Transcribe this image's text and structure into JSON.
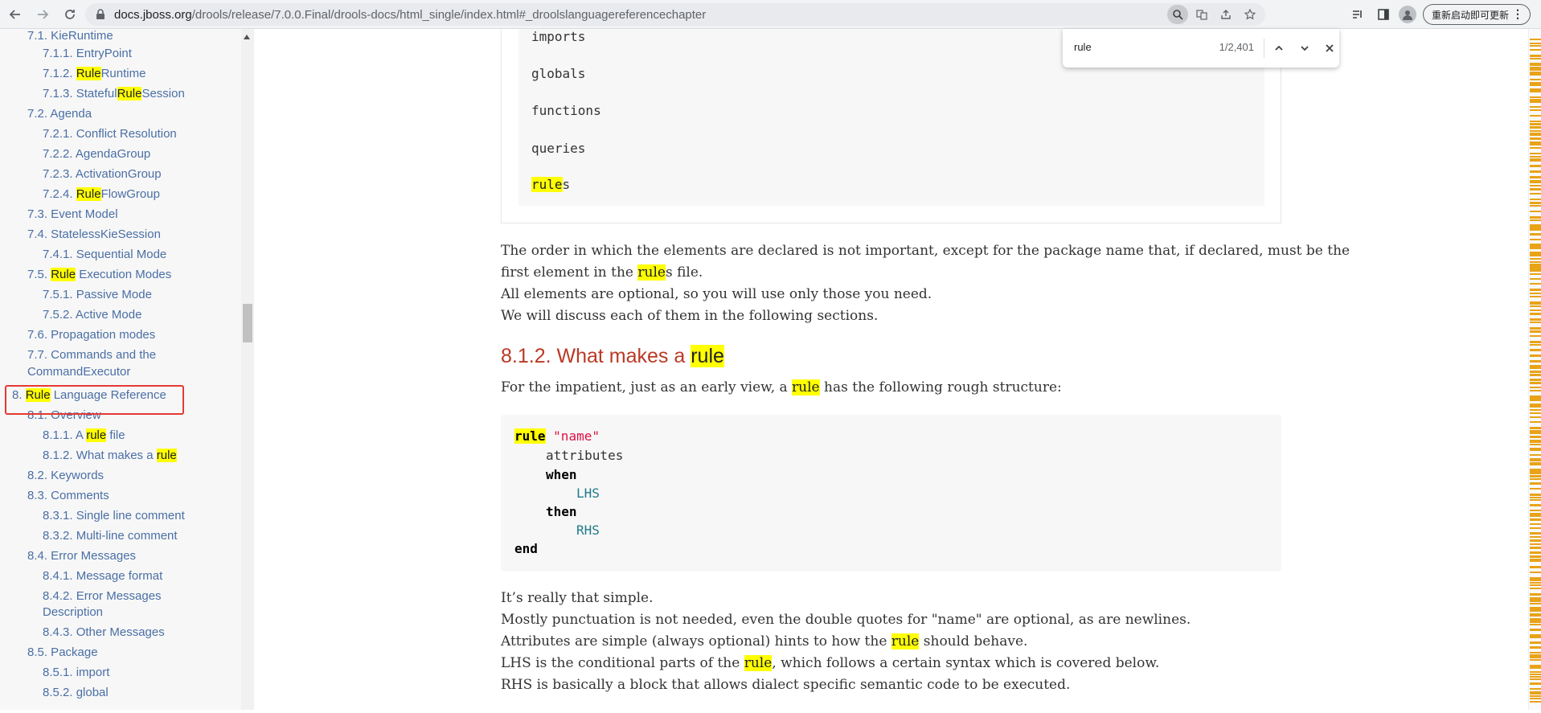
{
  "browser": {
    "url_host": "docs.jboss.org",
    "url_path": "/drools/release/7.0.0.Final/drools-docs/html_single/index.html#_droolslanguagereferencechapter",
    "update_button": "重新启动即可更新"
  },
  "find_bar": {
    "query": "rule",
    "count": "1/2,401"
  },
  "sidebar": {
    "items": [
      {
        "pre": "7.1. KieRuntime",
        "hl": "",
        "post": ""
      },
      {
        "pre": "7.1.1. EntryPoint",
        "hl": "",
        "post": ""
      },
      {
        "pre": "7.1.2. ",
        "hl": "Rule",
        "post": "Runtime"
      },
      {
        "pre": "7.1.3. Stateful",
        "hl": "Rule",
        "post": "Session"
      },
      {
        "pre": "7.2. Agenda",
        "hl": "",
        "post": ""
      },
      {
        "pre": "7.2.1. Conflict Resolution",
        "hl": "",
        "post": ""
      },
      {
        "pre": "7.2.2. AgendaGroup",
        "hl": "",
        "post": ""
      },
      {
        "pre": "7.2.3. ActivationGroup",
        "hl": "",
        "post": ""
      },
      {
        "pre": "7.2.4. ",
        "hl": "Rule",
        "post": "FlowGroup"
      },
      {
        "pre": "7.3. Event Model",
        "hl": "",
        "post": ""
      },
      {
        "pre": "7.4. StatelessKieSession",
        "hl": "",
        "post": ""
      },
      {
        "pre": "7.4.1. Sequential Mode",
        "hl": "",
        "post": ""
      },
      {
        "pre": "7.5. ",
        "hl": "Rule",
        "post": " Execution Modes"
      },
      {
        "pre": "7.5.1. Passive Mode",
        "hl": "",
        "post": ""
      },
      {
        "pre": "7.5.2. Active Mode",
        "hl": "",
        "post": ""
      },
      {
        "pre": "7.6. Propagation modes",
        "hl": "",
        "post": ""
      },
      {
        "pre": "7.7. Commands and the",
        "hl": "",
        "post": ""
      },
      {
        "pre": "CommandExecutor",
        "hl": "",
        "post": ""
      },
      {
        "pre": "8. ",
        "hl": "Rule",
        "post": " Language Reference"
      },
      {
        "pre": "8.1. Overview",
        "hl": "",
        "post": ""
      },
      {
        "pre": "8.1.1. A ",
        "hl": "rule",
        "post": " file"
      },
      {
        "pre": "8.1.2. What makes a ",
        "hl": "rule",
        "post": ""
      },
      {
        "pre": "8.2. Keywords",
        "hl": "",
        "post": ""
      },
      {
        "pre": "8.3. Comments",
        "hl": "",
        "post": ""
      },
      {
        "pre": "8.3.1. Single line comment",
        "hl": "",
        "post": ""
      },
      {
        "pre": "8.3.2. Multi-line comment",
        "hl": "",
        "post": ""
      },
      {
        "pre": "8.4. Error Messages",
        "hl": "",
        "post": ""
      },
      {
        "pre": "8.4.1. Message format",
        "hl": "",
        "post": ""
      },
      {
        "pre": "8.4.2. Error Messages",
        "hl": "",
        "post": ""
      },
      {
        "pre": "Description",
        "hl": "",
        "post": ""
      },
      {
        "pre": "8.4.3. Other Messages",
        "hl": "",
        "post": ""
      },
      {
        "pre": "8.5. Package",
        "hl": "",
        "post": ""
      },
      {
        "pre": "8.5.1. import",
        "hl": "",
        "post": ""
      },
      {
        "pre": "8.5.2. global",
        "hl": "",
        "post": ""
      }
    ]
  },
  "content": {
    "listing_lines": [
      "imports",
      "globals",
      "functions",
      "queries"
    ],
    "listing_last_hl": "rule",
    "listing_last_post": "s",
    "para1_line1": "The order in which the elements are declared is not important, except for the package name that, if declared, must be the",
    "para1_line2_pre": "first element in the ",
    "para1_line2_hl": "rule",
    "para1_line2_post": "s file.",
    "para1_line3": "All elements are optional, so you will use only those you need.",
    "para1_line4": "We will discuss each of them in the following sections.",
    "section_title_pre": "8.1.2. What makes a ",
    "section_title_hl": "rule",
    "intro_pre": "For the impatient, just as an early view, a ",
    "intro_hl": "rule",
    "intro_post": " has the following rough structure:",
    "code": {
      "rule_kw": "rule",
      "name_str": "\"name\"",
      "attributes": "attributes",
      "when": "when",
      "lhs": "LHS",
      "then": "then",
      "rhs": "RHS",
      "end": "end"
    },
    "p2_l1": "It’s really that simple.",
    "p2_l2": "Mostly punctuation is not needed, even the double quotes for \"name\" are optional, as are newlines.",
    "p2_l3_pre": "Attributes are simple (always optional) hints to how the ",
    "p2_l3_hl": "rule",
    "p2_l3_post": " should behave.",
    "p2_l4_pre": "LHS is the conditional parts of the ",
    "p2_l4_hl": "rule",
    "p2_l4_post": ", which follows a certain syntax which is covered below.",
    "p2_l5": "RHS is basically a block that allows dialect specific semantic code to be executed."
  },
  "colors": {
    "highlight": "#ffff00",
    "link": "#4a6fa5",
    "heading": "#ba3925",
    "scroll_marker": "#e8a317"
  }
}
